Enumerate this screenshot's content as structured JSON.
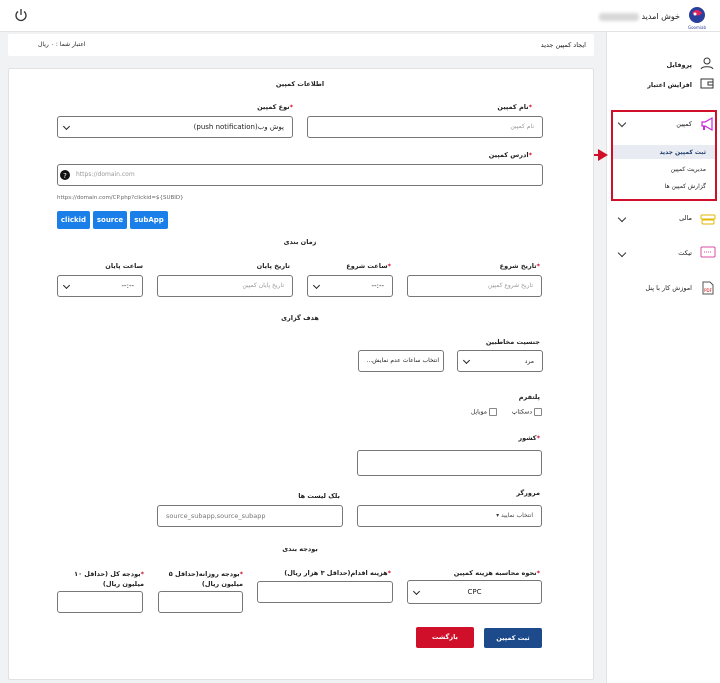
{
  "header": {
    "welcome": "خوش امدید",
    "logo_text": "Goomiab"
  },
  "breadcrumb": {
    "title": "ایجاد کمپین جدید",
    "credit": "اعتبار شما : ۰ ریال"
  },
  "sidebar": {
    "profile": "پروفایل",
    "increase_credit": "افزایش اعتبار",
    "campaign": "کمپین",
    "submenu": [
      "ثبت کمپین جدید",
      "مدیریت کمپین",
      "گزارش کمپین ها"
    ],
    "finance": "مالی",
    "ticket": "تیکت",
    "tutorial": "اموزش کار با پنل"
  },
  "form": {
    "section_info": "اطلاعات کمپین",
    "name_label": "نام کمپین",
    "name_placeholder": "نام کمپین",
    "type_label": "نوع کمپین",
    "type_value": "پوش وب(push notification)",
    "url_label": "ادرس کمپین",
    "url_placeholder": "https://domain.com",
    "url_hint": "https://domain.com/CP.php?clickid=${SUBID}",
    "tokens": [
      "clickid",
      "source",
      "subApp"
    ],
    "section_time": "زمان بندی",
    "start_date_label": "تاریخ شروع",
    "start_date_placeholder": "تاریخ شروع کمپین",
    "start_time_label": "ساعت شروع",
    "start_time_value": "--:--",
    "end_date_label": "تاریخ پایان",
    "end_date_placeholder": "تاریخ پایان کمپین",
    "end_time_label": "ساعت پایان",
    "end_time_value": "--:--",
    "section_target": "هدف گزاری",
    "gender_label": "جنسیت مخاطبین",
    "gender_value": "مرد",
    "hours_value": "انتخاب ساعات عدم نمایش...",
    "platform_label": "پلتفرم",
    "platform_desktop": "دسکتاپ",
    "platform_mobile": "موبایل",
    "country_label": "کشور",
    "browser_label": "مرورگر",
    "browser_placeholder": "انتخاب نمایید",
    "blacklist_label": "بلک لیست ها",
    "blacklist_placeholder": "source_subapp,source_subapp",
    "section_budget": "بودجه بندی",
    "cost_method_label": "نحوه محاسبه هزینه کمپین",
    "cost_method_value": "CPC",
    "action_cost_label": "هزینه اقدام(حداقل ۳ هزار ریال)",
    "daily_budget_label": "بودجه روزانه(حداقل ۵ میلیون ریال)",
    "total_budget_label": "بودجه کل (حداقل ۱۰ میلیون ریال)",
    "submit": "ثبت کمپین",
    "back": "بازگشت"
  },
  "colors": {
    "primary": "#1a7fe8",
    "navy": "#1d4a8a",
    "danger": "#d0102b"
  }
}
